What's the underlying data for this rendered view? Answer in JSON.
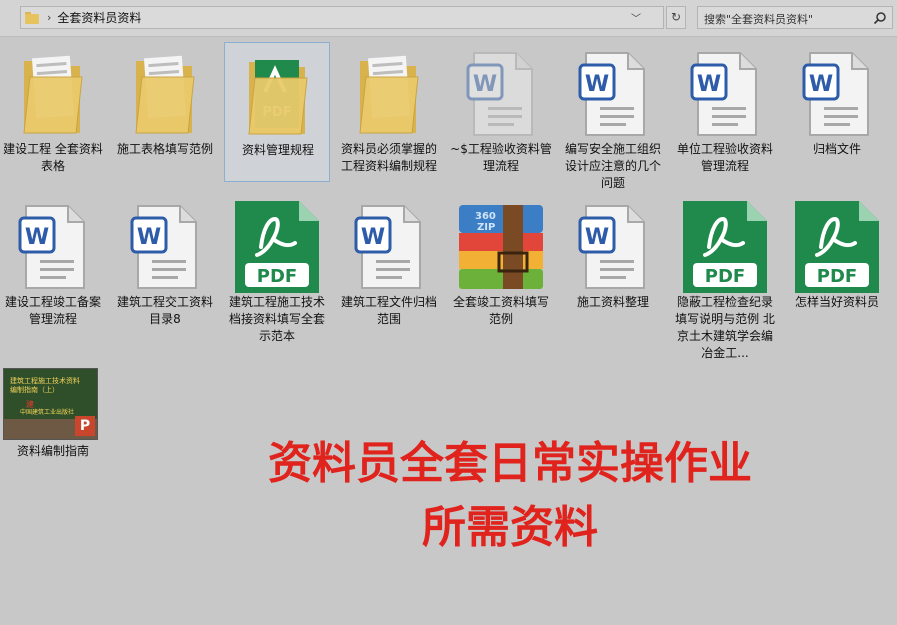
{
  "address_bar": {
    "path": "全套资料员资料",
    "search_placeholder": "搜索\"全套资料员资料\""
  },
  "items": [
    {
      "name": "建设工程 全套资料表格",
      "type": "folder"
    },
    {
      "name": "施工表格填写范例",
      "type": "folder"
    },
    {
      "name": "资料管理规程",
      "type": "pdf-folder",
      "selected": true
    },
    {
      "name": "资料员必须掌握的工程资料编制规程",
      "type": "folder"
    },
    {
      "name": "~$工程验收资料管理流程",
      "type": "word",
      "faded": true
    },
    {
      "name": "编写安全施工组织设计应注意的几个问题",
      "type": "word"
    },
    {
      "name": "单位工程验收资料管理流程",
      "type": "word"
    },
    {
      "name": "归档文件",
      "type": "word"
    },
    {
      "name": "建设工程竣工备案管理流程",
      "type": "word"
    },
    {
      "name": "建筑工程交工资料目录8",
      "type": "word"
    },
    {
      "name": "建筑工程施工技术档接资料填写全套示范本",
      "type": "pdf"
    },
    {
      "name": "建筑工程文件归档范围",
      "type": "word"
    },
    {
      "name": "全套竣工资料填写范例",
      "type": "zip"
    },
    {
      "name": "施工资料整理",
      "type": "word"
    },
    {
      "name": "隐蔽工程检查纪录填写说明与范例 北京土木建筑学会编 冶金工...",
      "type": "pdf"
    },
    {
      "name": "怎样当好资料员",
      "type": "pdf"
    }
  ],
  "guide": {
    "name": "资料编制指南",
    "thumb_title": "建筑工程施工技术资料\n编制指南（上）",
    "thumb_mid": "建",
    "thumb_sub": "中国建筑工业出版社"
  },
  "icon_labels": {
    "pdf": "PDF",
    "zip": "360\nZIP",
    "word": "W",
    "ppt": "P"
  },
  "banner": {
    "line1": "资料员全套日常实操作业",
    "line2": "所需资料"
  },
  "colors": {
    "word_blue": "#2d5ca8",
    "pdf_green": "#1f8a4c",
    "folder_yellow": "#e6c35e",
    "banner_red": "#e0231c"
  }
}
